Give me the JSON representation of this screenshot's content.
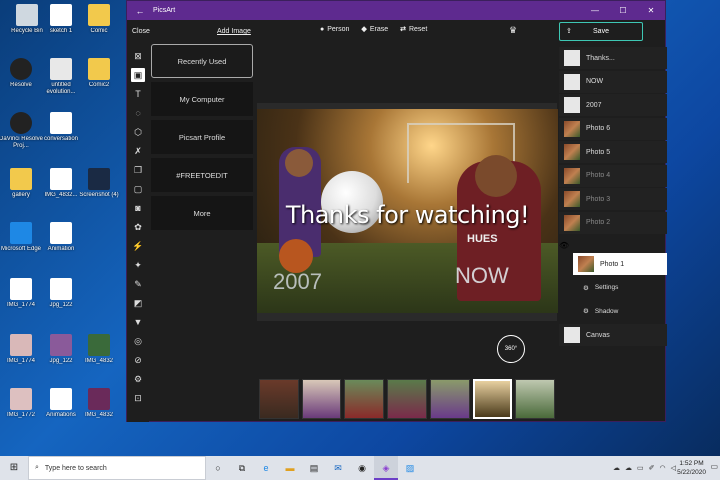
{
  "desktop": {
    "icons": [
      {
        "label": "Recycle Bin"
      },
      {
        "label": "sketch 1"
      },
      {
        "label": "Comic"
      },
      {
        "label": "Resolve"
      },
      {
        "label": "untitled evolution..."
      },
      {
        "label": "Comic2"
      },
      {
        "label": "DaVinci Resolve Proj..."
      },
      {
        "label": "conversation"
      },
      {
        "label": "gallery"
      },
      {
        "label": "IMG_4832..."
      },
      {
        "label": "Screenshot (4)"
      },
      {
        "label": "Microsoft Edge"
      },
      {
        "label": "Animation"
      },
      {
        "label": "IMG_1774"
      },
      {
        "label": "Jpg_122"
      },
      {
        "label": "IMG_1774"
      },
      {
        "label": "Jpg_122"
      },
      {
        "label": "IMG_4832"
      },
      {
        "label": "IMG_1772"
      },
      {
        "label": "Animations"
      },
      {
        "label": "IMG_4832"
      }
    ]
  },
  "app": {
    "title": "PicsArt",
    "toolbar": {
      "close": "Close",
      "add_image": "Add Image",
      "person": "Person",
      "erase": "Erase",
      "reset": "Reset",
      "save": "Save"
    },
    "menu": [
      "Recently Used",
      "My Computer",
      "Picsart Profile",
      "#FREETOEDIT",
      "More"
    ],
    "photo": {
      "title_text": "Thanks for watching!",
      "year_text": "2007",
      "now_text": "NOW",
      "jersey_text": "HUES"
    },
    "icon360": "360°",
    "layers": [
      {
        "label": "Thanks...",
        "kind": "text",
        "state": "normal"
      },
      {
        "label": "NOW",
        "kind": "text",
        "state": "normal"
      },
      {
        "label": "2007",
        "kind": "text",
        "state": "normal"
      },
      {
        "label": "Photo 6",
        "kind": "image",
        "state": "normal"
      },
      {
        "label": "Photo 5",
        "kind": "image",
        "state": "normal"
      },
      {
        "label": "Photo 4",
        "kind": "image",
        "state": "dim"
      },
      {
        "label": "Photo 3",
        "kind": "image",
        "state": "dim"
      },
      {
        "label": "Photo 2",
        "kind": "image",
        "state": "dim"
      },
      {
        "label": "Photo 1",
        "kind": "image",
        "state": "selected"
      }
    ],
    "layer_sub": [
      "Settings",
      "Shadow"
    ],
    "canvas_layer": "Canvas"
  },
  "taskbar": {
    "search_placeholder": "Type here to search",
    "time": "1:52 PM",
    "date": "5/22/2020"
  },
  "colors": {
    "title_bar": "#5e2a8f",
    "save_border": "#3ec7b4",
    "taskbar": "#dfe3ea"
  }
}
